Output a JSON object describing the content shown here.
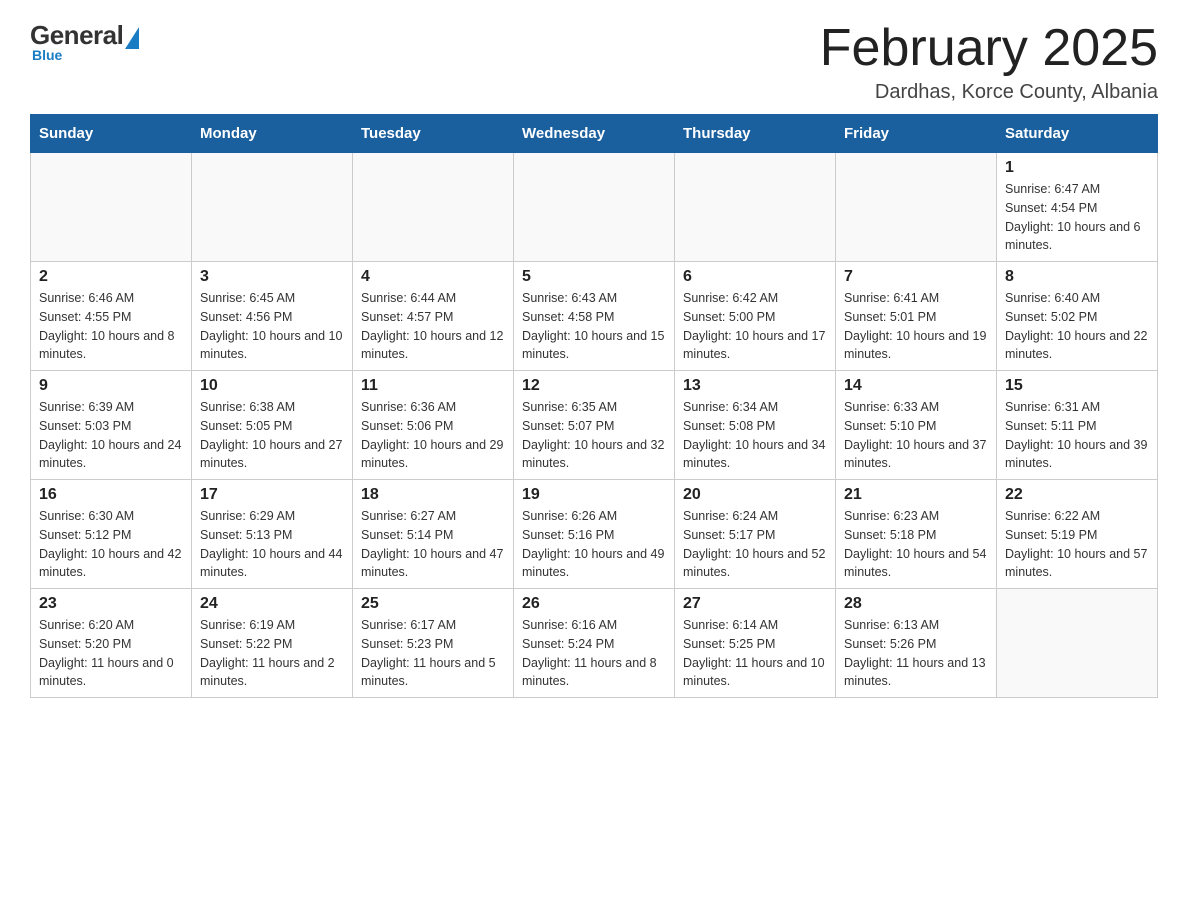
{
  "header": {
    "logo": {
      "general": "General",
      "blue": "Blue",
      "subtitle": "Blue"
    },
    "title": "February 2025",
    "location": "Dardhas, Korce County, Albania"
  },
  "calendar": {
    "days_of_week": [
      "Sunday",
      "Monday",
      "Tuesday",
      "Wednesday",
      "Thursday",
      "Friday",
      "Saturday"
    ],
    "weeks": [
      [
        {
          "day": "",
          "info": ""
        },
        {
          "day": "",
          "info": ""
        },
        {
          "day": "",
          "info": ""
        },
        {
          "day": "",
          "info": ""
        },
        {
          "day": "",
          "info": ""
        },
        {
          "day": "",
          "info": ""
        },
        {
          "day": "1",
          "info": "Sunrise: 6:47 AM\nSunset: 4:54 PM\nDaylight: 10 hours and 6 minutes."
        }
      ],
      [
        {
          "day": "2",
          "info": "Sunrise: 6:46 AM\nSunset: 4:55 PM\nDaylight: 10 hours and 8 minutes."
        },
        {
          "day": "3",
          "info": "Sunrise: 6:45 AM\nSunset: 4:56 PM\nDaylight: 10 hours and 10 minutes."
        },
        {
          "day": "4",
          "info": "Sunrise: 6:44 AM\nSunset: 4:57 PM\nDaylight: 10 hours and 12 minutes."
        },
        {
          "day": "5",
          "info": "Sunrise: 6:43 AM\nSunset: 4:58 PM\nDaylight: 10 hours and 15 minutes."
        },
        {
          "day": "6",
          "info": "Sunrise: 6:42 AM\nSunset: 5:00 PM\nDaylight: 10 hours and 17 minutes."
        },
        {
          "day": "7",
          "info": "Sunrise: 6:41 AM\nSunset: 5:01 PM\nDaylight: 10 hours and 19 minutes."
        },
        {
          "day": "8",
          "info": "Sunrise: 6:40 AM\nSunset: 5:02 PM\nDaylight: 10 hours and 22 minutes."
        }
      ],
      [
        {
          "day": "9",
          "info": "Sunrise: 6:39 AM\nSunset: 5:03 PM\nDaylight: 10 hours and 24 minutes."
        },
        {
          "day": "10",
          "info": "Sunrise: 6:38 AM\nSunset: 5:05 PM\nDaylight: 10 hours and 27 minutes."
        },
        {
          "day": "11",
          "info": "Sunrise: 6:36 AM\nSunset: 5:06 PM\nDaylight: 10 hours and 29 minutes."
        },
        {
          "day": "12",
          "info": "Sunrise: 6:35 AM\nSunset: 5:07 PM\nDaylight: 10 hours and 32 minutes."
        },
        {
          "day": "13",
          "info": "Sunrise: 6:34 AM\nSunset: 5:08 PM\nDaylight: 10 hours and 34 minutes."
        },
        {
          "day": "14",
          "info": "Sunrise: 6:33 AM\nSunset: 5:10 PM\nDaylight: 10 hours and 37 minutes."
        },
        {
          "day": "15",
          "info": "Sunrise: 6:31 AM\nSunset: 5:11 PM\nDaylight: 10 hours and 39 minutes."
        }
      ],
      [
        {
          "day": "16",
          "info": "Sunrise: 6:30 AM\nSunset: 5:12 PM\nDaylight: 10 hours and 42 minutes."
        },
        {
          "day": "17",
          "info": "Sunrise: 6:29 AM\nSunset: 5:13 PM\nDaylight: 10 hours and 44 minutes."
        },
        {
          "day": "18",
          "info": "Sunrise: 6:27 AM\nSunset: 5:14 PM\nDaylight: 10 hours and 47 minutes."
        },
        {
          "day": "19",
          "info": "Sunrise: 6:26 AM\nSunset: 5:16 PM\nDaylight: 10 hours and 49 minutes."
        },
        {
          "day": "20",
          "info": "Sunrise: 6:24 AM\nSunset: 5:17 PM\nDaylight: 10 hours and 52 minutes."
        },
        {
          "day": "21",
          "info": "Sunrise: 6:23 AM\nSunset: 5:18 PM\nDaylight: 10 hours and 54 minutes."
        },
        {
          "day": "22",
          "info": "Sunrise: 6:22 AM\nSunset: 5:19 PM\nDaylight: 10 hours and 57 minutes."
        }
      ],
      [
        {
          "day": "23",
          "info": "Sunrise: 6:20 AM\nSunset: 5:20 PM\nDaylight: 11 hours and 0 minutes."
        },
        {
          "day": "24",
          "info": "Sunrise: 6:19 AM\nSunset: 5:22 PM\nDaylight: 11 hours and 2 minutes."
        },
        {
          "day": "25",
          "info": "Sunrise: 6:17 AM\nSunset: 5:23 PM\nDaylight: 11 hours and 5 minutes."
        },
        {
          "day": "26",
          "info": "Sunrise: 6:16 AM\nSunset: 5:24 PM\nDaylight: 11 hours and 8 minutes."
        },
        {
          "day": "27",
          "info": "Sunrise: 6:14 AM\nSunset: 5:25 PM\nDaylight: 11 hours and 10 minutes."
        },
        {
          "day": "28",
          "info": "Sunrise: 6:13 AM\nSunset: 5:26 PM\nDaylight: 11 hours and 13 minutes."
        },
        {
          "day": "",
          "info": ""
        }
      ]
    ]
  }
}
